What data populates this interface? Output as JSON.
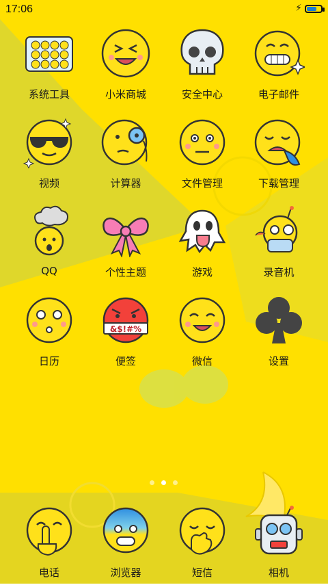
{
  "status_bar": {
    "time": "17:06",
    "battery_level": 0.8
  },
  "rows": [
    [
      {
        "name": "系统工具",
        "icon": "tools-grid-icon"
      },
      {
        "name": "小米商城",
        "icon": "grinning-face-icon"
      },
      {
        "name": "安全中心",
        "icon": "skull-icon"
      },
      {
        "name": "电子邮件",
        "icon": "sparkle-grin-face-icon"
      }
    ],
    [
      {
        "name": "视频",
        "icon": "sunglasses-face-icon"
      },
      {
        "name": "计算器",
        "icon": "monocle-face-icon"
      },
      {
        "name": "文件管理",
        "icon": "neutral-face-icon"
      },
      {
        "name": "下载管理",
        "icon": "drooling-face-icon"
      }
    ],
    [
      {
        "name": "QQ",
        "icon": "exploding-head-icon"
      },
      {
        "name": "个性主题",
        "icon": "bow-icon"
      },
      {
        "name": "游戏",
        "icon": "ghost-icon"
      },
      {
        "name": "录音机",
        "icon": "robot-icon"
      }
    ],
    [
      {
        "name": "日历",
        "icon": "surprised-face-icon"
      },
      {
        "name": "便签",
        "icon": "cursing-face-icon"
      },
      {
        "name": "微信",
        "icon": "laughing-face-icon"
      },
      {
        "name": "设置",
        "icon": "club-icon"
      }
    ]
  ],
  "cursing_text": "&$!#%",
  "page_indicator": {
    "count": 3,
    "active": 1
  },
  "dock": [
    {
      "name": "电话",
      "icon": "shushing-face-icon"
    },
    {
      "name": "浏览器",
      "icon": "fearful-face-icon"
    },
    {
      "name": "短信",
      "icon": "hand-over-mouth-face-icon"
    },
    {
      "name": "相机",
      "icon": "robot-head-icon"
    }
  ],
  "colors": {
    "background": "#ffe000",
    "face": "#ffe11a",
    "outline": "#333333",
    "cheek": "#ff9a8a",
    "accent_blue": "#2f8fe0"
  }
}
